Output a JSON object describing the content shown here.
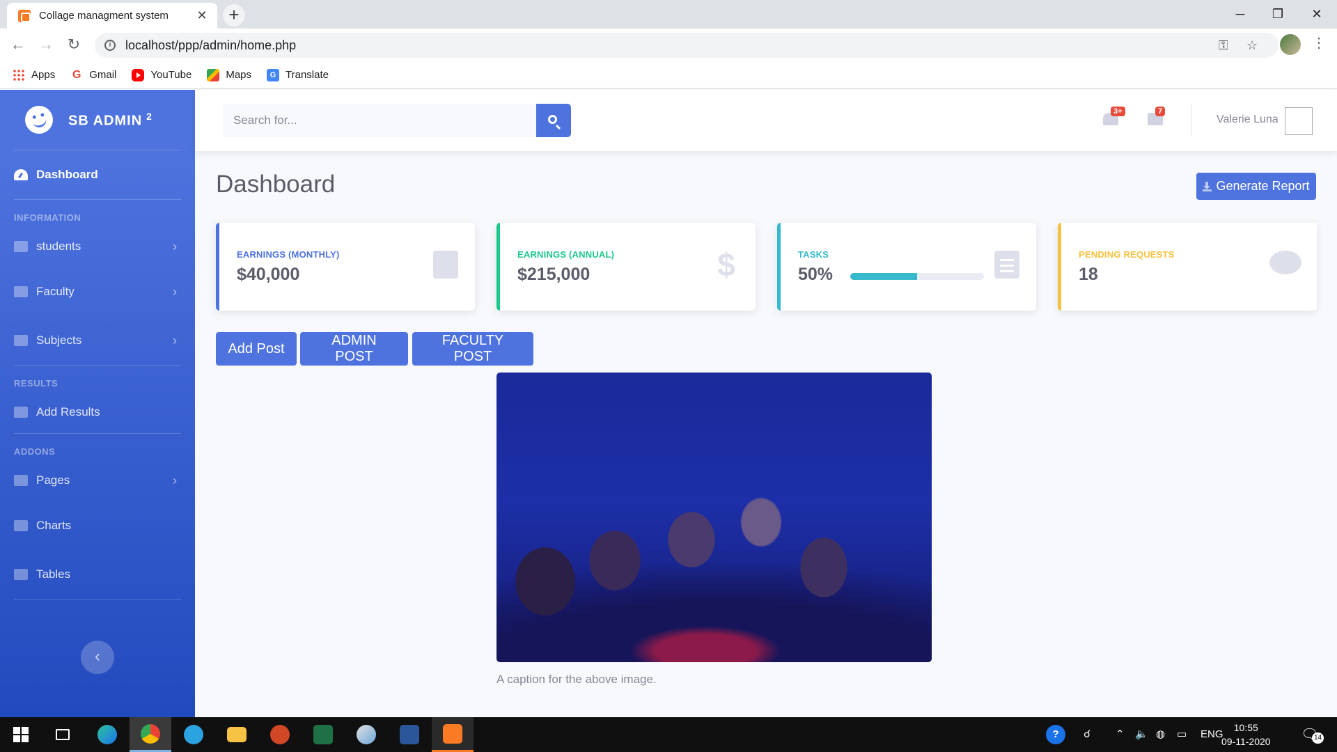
{
  "browser": {
    "tab_title": "Collage managment system",
    "tab_close": "✕",
    "new_tab": "+",
    "url": "localhost/ppp/admin/home.php",
    "window_controls": {
      "minimize": "─",
      "restore": "❐",
      "close": "✕"
    },
    "nav": {
      "back": "←",
      "forward": "→",
      "reload": "↻"
    },
    "bookmarks": [
      {
        "label": "Apps",
        "icon": "apps-grid-icon"
      },
      {
        "label": "Gmail",
        "icon": "google-icon"
      },
      {
        "label": "YouTube",
        "icon": "youtube-icon"
      },
      {
        "label": "Maps",
        "icon": "maps-icon"
      },
      {
        "label": "Translate",
        "icon": "translate-icon"
      }
    ]
  },
  "sidebar": {
    "brand": "SB ADMIN",
    "brand_sup": "2",
    "dashboard": "Dashboard",
    "sections": {
      "information": "INFORMATION",
      "results": "RESULTS",
      "addons": "ADDONS"
    },
    "items": {
      "students": "students",
      "faculty": "Faculty",
      "subjects": "Subjects",
      "add_results": "Add Results",
      "pages": "Pages",
      "charts": "Charts",
      "tables": "Tables"
    },
    "chevron": "›",
    "toggle": "‹"
  },
  "topbar": {
    "search_placeholder": "Search for...",
    "alerts_badge": "3+",
    "messages_badge": "7",
    "user_name": "Valerie Luna"
  },
  "main": {
    "title": "Dashboard",
    "generate_report": "Generate Report",
    "cards": [
      {
        "label": "EARNINGS (MONTHLY)",
        "value": "$40,000",
        "color": "#4e73df",
        "icon": "calendar-icon"
      },
      {
        "label": "EARNINGS (ANNUAL)",
        "value": "$215,000",
        "color": "#1cc88a",
        "icon": "dollar-icon"
      },
      {
        "label": "TASKS",
        "value": "50%",
        "progress": 0.5,
        "color": "#36b9cc",
        "icon": "clipboard-list-icon"
      },
      {
        "label": "PENDING REQUESTS",
        "value": "18",
        "color": "#f6c23e",
        "icon": "comments-icon"
      }
    ],
    "buttons": {
      "add_post": "Add Post",
      "admin_post": "ADMIN POST",
      "faculty_post": "FACULTY POST"
    },
    "image_caption": "A caption for the above image."
  },
  "taskbar": {
    "language": "ENG",
    "time": "10:55",
    "date": "09-11-2020",
    "notifications": "14",
    "accent": "#7bb0e0"
  }
}
